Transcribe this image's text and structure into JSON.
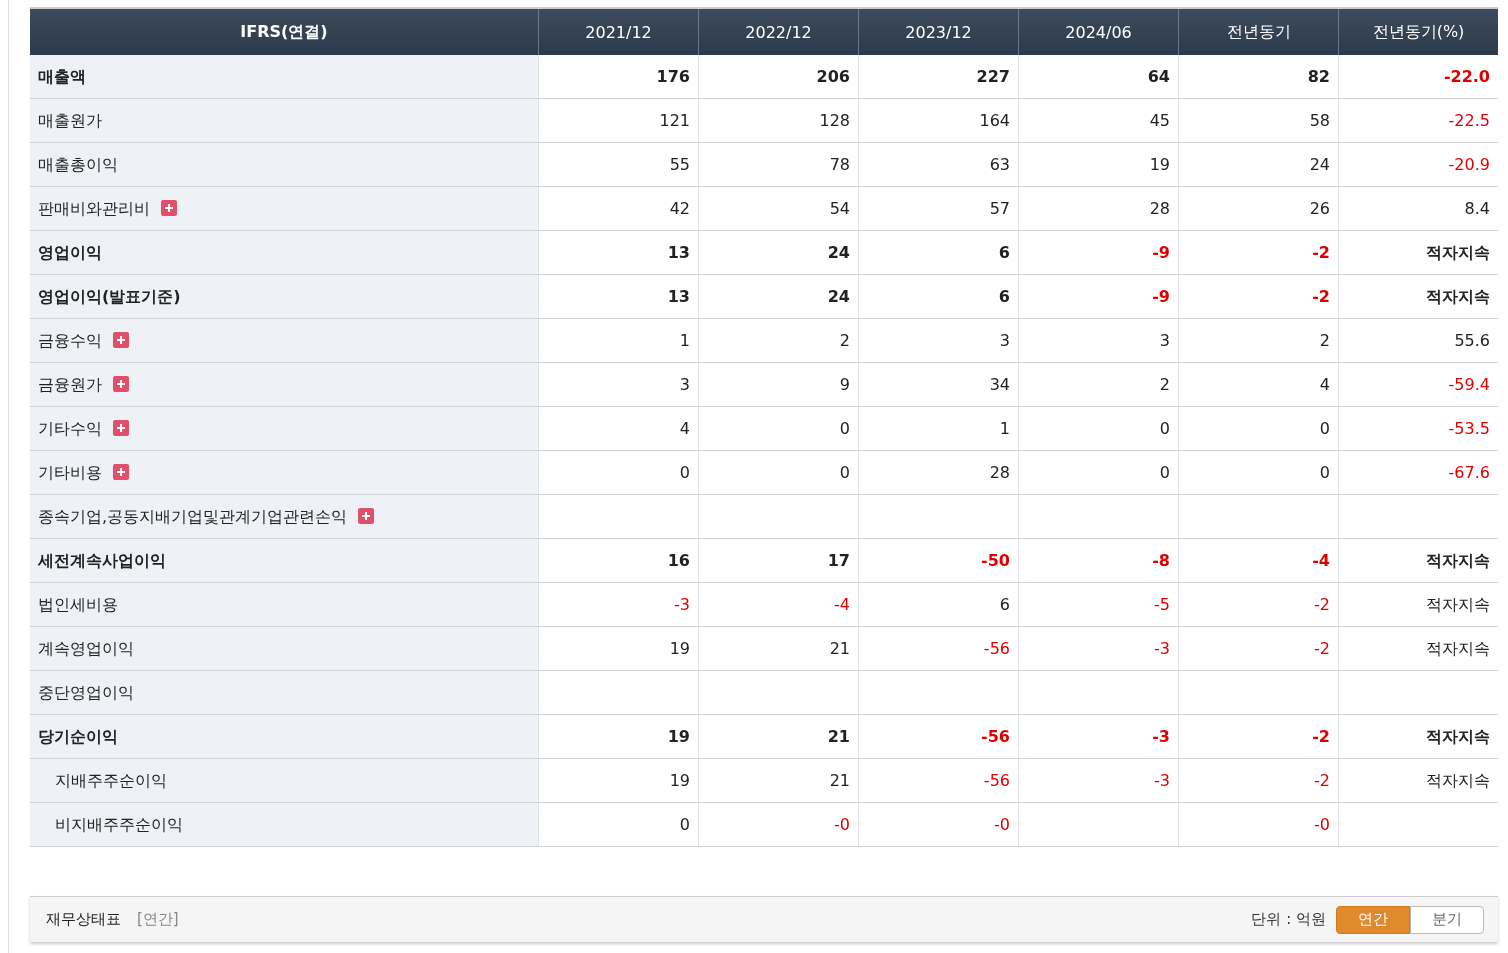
{
  "table": {
    "header_label": "IFRS(연결)",
    "columns": [
      "2021/12",
      "2022/12",
      "2023/12",
      "2024/06",
      "전년동기",
      "전년동기(%)"
    ],
    "rows": [
      {
        "label": "매출액",
        "bold": true,
        "expandable": false,
        "cells": [
          {
            "kind": "value",
            "text": "176",
            "negative": false
          },
          {
            "kind": "value",
            "text": "206",
            "negative": false
          },
          {
            "kind": "value",
            "text": "227",
            "negative": false
          },
          {
            "kind": "value",
            "text": "64",
            "negative": false
          },
          {
            "kind": "value",
            "text": "82",
            "negative": false
          },
          {
            "kind": "value",
            "text": "-22.0",
            "negative": true
          }
        ]
      },
      {
        "label": "매출원가",
        "bold": false,
        "expandable": false,
        "cells": [
          {
            "kind": "value",
            "text": "121",
            "negative": false
          },
          {
            "kind": "value",
            "text": "128",
            "negative": false
          },
          {
            "kind": "value",
            "text": "164",
            "negative": false
          },
          {
            "kind": "value",
            "text": "45",
            "negative": false
          },
          {
            "kind": "value",
            "text": "58",
            "negative": false
          },
          {
            "kind": "value",
            "text": "-22.5",
            "negative": true
          }
        ]
      },
      {
        "label": "매출총이익",
        "bold": false,
        "expandable": false,
        "cells": [
          {
            "kind": "value",
            "text": "55",
            "negative": false
          },
          {
            "kind": "value",
            "text": "78",
            "negative": false
          },
          {
            "kind": "value",
            "text": "63",
            "negative": false
          },
          {
            "kind": "value",
            "text": "19",
            "negative": false
          },
          {
            "kind": "value",
            "text": "24",
            "negative": false
          },
          {
            "kind": "value",
            "text": "-20.9",
            "negative": true
          }
        ]
      },
      {
        "label": "판매비와관리비",
        "bold": false,
        "expandable": true,
        "cells": [
          {
            "kind": "value",
            "text": "42",
            "negative": false
          },
          {
            "kind": "value",
            "text": "54",
            "negative": false
          },
          {
            "kind": "value",
            "text": "57",
            "negative": false
          },
          {
            "kind": "value",
            "text": "28",
            "negative": false
          },
          {
            "kind": "value",
            "text": "26",
            "negative": false
          },
          {
            "kind": "value",
            "text": "8.4",
            "negative": false
          }
        ]
      },
      {
        "label": "영업이익",
        "bold": true,
        "expandable": false,
        "cells": [
          {
            "kind": "value",
            "text": "13",
            "negative": false
          },
          {
            "kind": "value",
            "text": "24",
            "negative": false
          },
          {
            "kind": "value",
            "text": "6",
            "negative": false
          },
          {
            "kind": "value",
            "text": "-9",
            "negative": true
          },
          {
            "kind": "value",
            "text": "-2",
            "negative": true
          },
          {
            "kind": "value",
            "text": "적자지속",
            "negative": false
          }
        ]
      },
      {
        "label": "영업이익(발표기준)",
        "bold": true,
        "expandable": false,
        "cells": [
          {
            "kind": "value",
            "text": "13",
            "negative": false
          },
          {
            "kind": "value",
            "text": "24",
            "negative": false
          },
          {
            "kind": "value",
            "text": "6",
            "negative": false
          },
          {
            "kind": "value",
            "text": "-9",
            "negative": true
          },
          {
            "kind": "value",
            "text": "-2",
            "negative": true
          },
          {
            "kind": "value",
            "text": "적자지속",
            "negative": false
          }
        ]
      },
      {
        "label": "금융수익",
        "bold": false,
        "expandable": true,
        "cells": [
          {
            "kind": "value",
            "text": "1",
            "negative": false
          },
          {
            "kind": "value",
            "text": "2",
            "negative": false
          },
          {
            "kind": "value",
            "text": "3",
            "negative": false
          },
          {
            "kind": "value",
            "text": "3",
            "negative": false
          },
          {
            "kind": "value",
            "text": "2",
            "negative": false
          },
          {
            "kind": "value",
            "text": "55.6",
            "negative": false
          }
        ]
      },
      {
        "label": "금융원가",
        "bold": false,
        "expandable": true,
        "cells": [
          {
            "kind": "value",
            "text": "3",
            "negative": false
          },
          {
            "kind": "value",
            "text": "9",
            "negative": false
          },
          {
            "kind": "value",
            "text": "34",
            "negative": false
          },
          {
            "kind": "value",
            "text": "2",
            "negative": false
          },
          {
            "kind": "value",
            "text": "4",
            "negative": false
          },
          {
            "kind": "value",
            "text": "-59.4",
            "negative": true
          }
        ]
      },
      {
        "label": "기타수익",
        "bold": false,
        "expandable": true,
        "cells": [
          {
            "kind": "value",
            "text": "4",
            "negative": false
          },
          {
            "kind": "value",
            "text": "0",
            "negative": false
          },
          {
            "kind": "value",
            "text": "1",
            "negative": false
          },
          {
            "kind": "value",
            "text": "0",
            "negative": false
          },
          {
            "kind": "value",
            "text": "0",
            "negative": false
          },
          {
            "kind": "value",
            "text": "-53.5",
            "negative": true
          }
        ]
      },
      {
        "label": "기타비용",
        "bold": false,
        "expandable": true,
        "cells": [
          {
            "kind": "value",
            "text": "0",
            "negative": false
          },
          {
            "kind": "value",
            "text": "0",
            "negative": false
          },
          {
            "kind": "value",
            "text": "28",
            "negative": false
          },
          {
            "kind": "value",
            "text": "0",
            "negative": false
          },
          {
            "kind": "value",
            "text": "0",
            "negative": false
          },
          {
            "kind": "value",
            "text": "-67.6",
            "negative": true
          }
        ]
      },
      {
        "label": "종속기업,공동지배기업및관계기업관련손익",
        "bold": false,
        "expandable": true,
        "cells": [
          {
            "kind": "blank"
          },
          {
            "kind": "blank"
          },
          {
            "kind": "blank"
          },
          {
            "kind": "blank"
          },
          {
            "kind": "blank"
          },
          {
            "kind": "blank"
          }
        ]
      },
      {
        "label": "세전계속사업이익",
        "bold": true,
        "expandable": false,
        "cells": [
          {
            "kind": "value",
            "text": "16",
            "negative": false
          },
          {
            "kind": "value",
            "text": "17",
            "negative": false
          },
          {
            "kind": "value",
            "text": "-50",
            "negative": true
          },
          {
            "kind": "value",
            "text": "-8",
            "negative": true
          },
          {
            "kind": "value",
            "text": "-4",
            "negative": true
          },
          {
            "kind": "value",
            "text": "적자지속",
            "negative": false
          }
        ]
      },
      {
        "label": "법인세비용",
        "bold": false,
        "expandable": false,
        "cells": [
          {
            "kind": "value",
            "text": "-3",
            "negative": true
          },
          {
            "kind": "value",
            "text": "-4",
            "negative": true
          },
          {
            "kind": "value",
            "text": "6",
            "negative": false
          },
          {
            "kind": "value",
            "text": "-5",
            "negative": true
          },
          {
            "kind": "value",
            "text": "-2",
            "negative": true
          },
          {
            "kind": "value",
            "text": "적자지속",
            "negative": false
          }
        ]
      },
      {
        "label": "계속영업이익",
        "bold": false,
        "expandable": false,
        "cells": [
          {
            "kind": "value",
            "text": "19",
            "negative": false
          },
          {
            "kind": "value",
            "text": "21",
            "negative": false
          },
          {
            "kind": "value",
            "text": "-56",
            "negative": true
          },
          {
            "kind": "value",
            "text": "-3",
            "negative": true
          },
          {
            "kind": "value",
            "text": "-2",
            "negative": true
          },
          {
            "kind": "value",
            "text": "적자지속",
            "negative": false
          }
        ]
      },
      {
        "label": "중단영업이익",
        "bold": false,
        "expandable": false,
        "cells": [
          {
            "kind": "blank"
          },
          {
            "kind": "blank"
          },
          {
            "kind": "blank"
          },
          {
            "kind": "blank"
          },
          {
            "kind": "blank"
          },
          {
            "kind": "blank"
          }
        ]
      },
      {
        "label": "당기순이익",
        "bold": true,
        "expandable": false,
        "cells": [
          {
            "kind": "value",
            "text": "19",
            "negative": false
          },
          {
            "kind": "value",
            "text": "21",
            "negative": false
          },
          {
            "kind": "value",
            "text": "-56",
            "negative": true
          },
          {
            "kind": "value",
            "text": "-3",
            "negative": true
          },
          {
            "kind": "value",
            "text": "-2",
            "negative": true
          },
          {
            "kind": "value",
            "text": "적자지속",
            "negative": false
          }
        ],
        "children": [
          {
            "label": "지배주주순이익",
            "bold": false,
            "expandable": false,
            "cells": [
              {
                "kind": "value",
                "text": "19",
                "negative": false
              },
              {
                "kind": "value",
                "text": "21",
                "negative": false
              },
              {
                "kind": "value",
                "text": "-56",
                "negative": true
              },
              {
                "kind": "value",
                "text": "-3",
                "negative": true
              },
              {
                "kind": "value",
                "text": "-2",
                "negative": true
              },
              {
                "kind": "value",
                "text": "적자지속",
                "negative": false
              }
            ]
          },
          {
            "label": "비지배주주순이익",
            "bold": false,
            "expandable": false,
            "cells": [
              {
                "kind": "value",
                "text": "0",
                "negative": false
              },
              {
                "kind": "value",
                "text": "-0",
                "negative": true
              },
              {
                "kind": "value",
                "text": "-0",
                "negative": true
              },
              {
                "kind": "blank"
              },
              {
                "kind": "value",
                "text": "-0",
                "negative": true
              },
              {
                "kind": "blank"
              }
            ]
          }
        ]
      }
    ]
  },
  "footer": {
    "title": "재무상태표",
    "period": "[연간]",
    "unit": "단위 : 억원",
    "toggles": [
      {
        "label": "연간",
        "selected": true
      },
      {
        "label": "분기",
        "selected": false
      }
    ]
  }
}
